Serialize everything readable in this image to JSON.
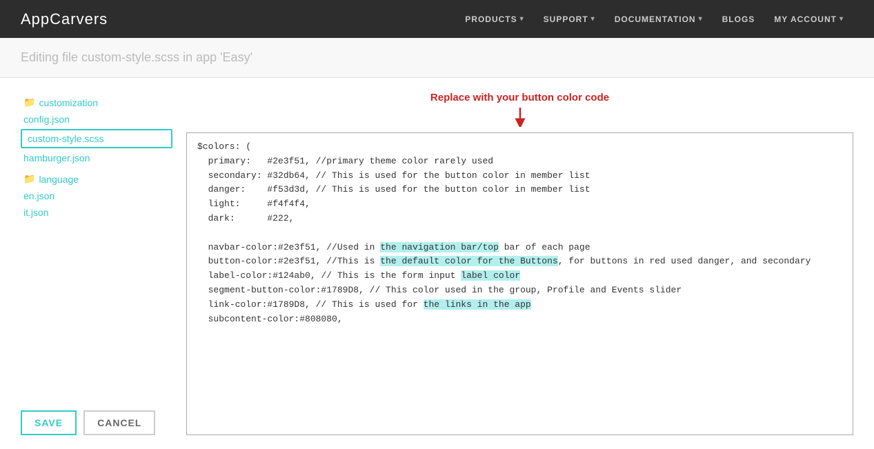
{
  "navbar": {
    "brand": "AppCarvers",
    "links": [
      {
        "label": "PRODUCTS",
        "has_dropdown": true
      },
      {
        "label": "SUPPORT",
        "has_dropdown": true
      },
      {
        "label": "DOCUMENTATION",
        "has_dropdown": true
      },
      {
        "label": "BLOGS",
        "has_dropdown": false
      },
      {
        "label": "MY ACCOUNT",
        "has_dropdown": true
      }
    ]
  },
  "page_header": {
    "text": "Editing file custom-style.scss in app 'Easy'"
  },
  "sidebar": {
    "items": [
      {
        "id": "customization",
        "label": "customization",
        "is_folder": true
      },
      {
        "id": "config.json",
        "label": "config.json",
        "is_folder": false
      },
      {
        "id": "custom-style.scss",
        "label": "custom-style.scss",
        "is_folder": false,
        "active": true
      },
      {
        "id": "hamburger.json",
        "label": "hamburger.json",
        "is_folder": false
      },
      {
        "id": "language",
        "label": "language",
        "is_folder": true
      },
      {
        "id": "en.json",
        "label": "en.json",
        "is_folder": false
      },
      {
        "id": "it.json",
        "label": "it.json",
        "is_folder": false
      }
    ],
    "save_label": "SAVE",
    "cancel_label": "CANCEL"
  },
  "editor": {
    "hint_text": "Replace with your button color code",
    "code_lines": [
      {
        "text": "$colors: (",
        "highlights": []
      },
      {
        "text": "  primary:   #2e3f51, //primary theme color rarely used",
        "highlights": []
      },
      {
        "text": "  secondary: #32db64, // This is used for the button color in member list",
        "highlights": []
      },
      {
        "text": "  danger:    #f53d3d, // This is used for the button color in member list",
        "highlights": []
      },
      {
        "text": "  light:     #f4f4f4,",
        "highlights": []
      },
      {
        "text": "  dark:      #222,",
        "highlights": []
      },
      {
        "text": "",
        "highlights": []
      },
      {
        "text": "  navbar-color:#2e3f51, //Used in the navigation bar/top bar of each page",
        "highlights": [
          {
            "start": 28,
            "end": 51,
            "type": "teal"
          }
        ]
      },
      {
        "text": "  button-color:#2e3f51, //This is the default color for the Buttons, for buttons in red used danger, and secondary",
        "highlights": [
          {
            "start": 31,
            "end": 65,
            "type": "teal"
          }
        ]
      },
      {
        "text": "  label-color:#124ab0, // This is the form input label color",
        "highlights": [
          {
            "start": 44,
            "end": 55,
            "type": "cyan"
          }
        ]
      },
      {
        "text": "  segment-button-color:#1789D8, // This color used in the group, Profile and Events slider",
        "highlights": []
      },
      {
        "text": "  link-color:#1789D8, // This is used for the links in the app",
        "highlights": [
          {
            "start": 42,
            "end": 62,
            "type": "cyan"
          }
        ]
      },
      {
        "text": "  subcontent-color:#808080,",
        "highlights": []
      }
    ]
  }
}
